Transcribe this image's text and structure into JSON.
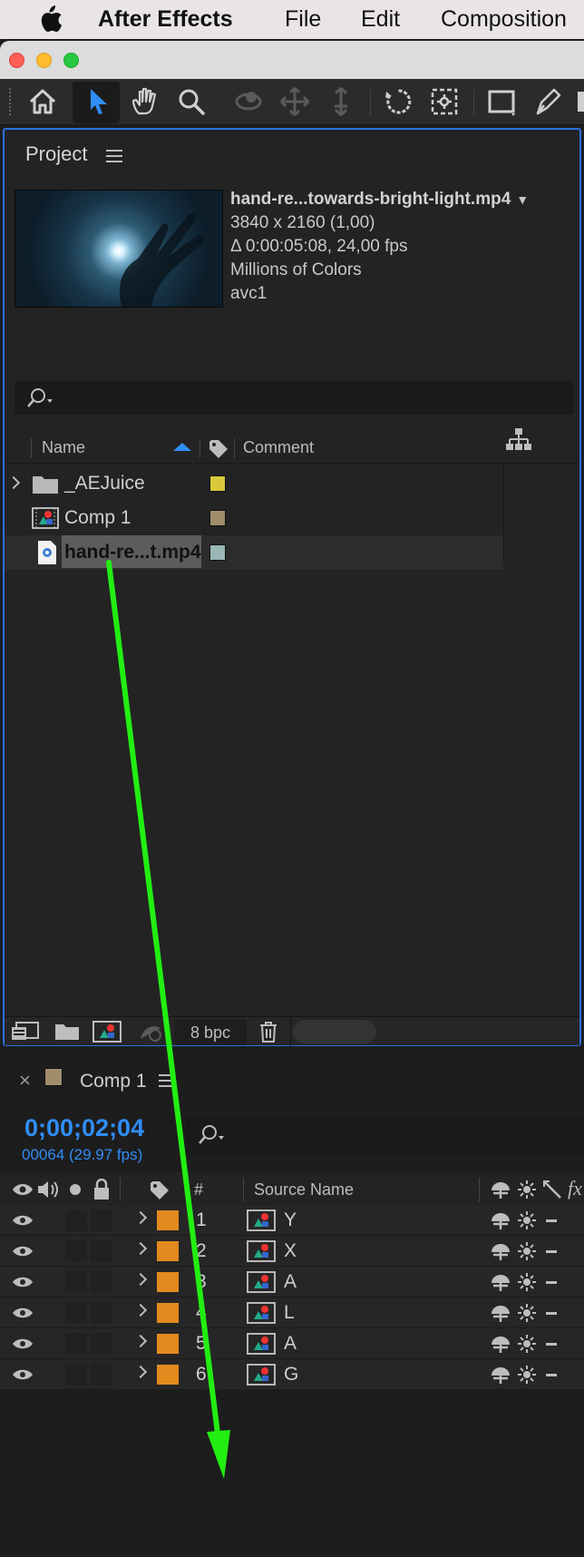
{
  "menubar": {
    "app_name": "After Effects",
    "items": [
      "File",
      "Edit",
      "Composition"
    ]
  },
  "toolbar": {
    "tools": [
      "home-icon",
      "selection-tool-icon",
      "hand-tool-icon",
      "zoom-tool-icon",
      "orbit-camera-icon",
      "pan-camera-icon",
      "dolly-camera-icon",
      "rotate-tool-icon",
      "anchor-point-tool-icon",
      "rectangle-tool-icon",
      "pen-tool-icon"
    ]
  },
  "project": {
    "title": "Project",
    "footage": {
      "name": "hand-re...towards-bright-light.mp4",
      "dimensions": "3840 x 2160 (1,00)",
      "duration": "Δ 0:00:05:08, 24,00 fps",
      "colors": "Millions of Colors",
      "codec": "avc1"
    },
    "columns": {
      "name": "Name",
      "comment": "Comment"
    },
    "items": [
      {
        "name": "_AEJuice",
        "type": "folder",
        "label_color": "#d9c93a"
      },
      {
        "name": "Comp 1",
        "type": "composition",
        "label_color": "#a08d6c"
      },
      {
        "name": "hand-re...t.mp4",
        "type": "footage",
        "label_color": "#9ab7b5",
        "selected": true
      }
    ],
    "footer": {
      "bpc": "8 bpc"
    }
  },
  "timeline": {
    "comp_name": "Comp 1",
    "comp_label_color": "#a08d6c",
    "timecode": "0;00;02;04",
    "frames": "00064 (29.97 fps)",
    "columns": {
      "number": "#",
      "source_name": "Source Name"
    },
    "layers": [
      {
        "num": "1",
        "name": "Y",
        "label_color": "#e38a1e"
      },
      {
        "num": "2",
        "name": "X",
        "label_color": "#e38a1e"
      },
      {
        "num": "3",
        "name": "A",
        "label_color": "#e38a1e"
      },
      {
        "num": "4",
        "name": "L",
        "label_color": "#e38a1e"
      },
      {
        "num": "5",
        "name": "A",
        "label_color": "#e38a1e"
      },
      {
        "num": "6",
        "name": "G",
        "label_color": "#e38a1e"
      }
    ]
  },
  "annotation": {
    "arrow_color": "#22ee11"
  }
}
